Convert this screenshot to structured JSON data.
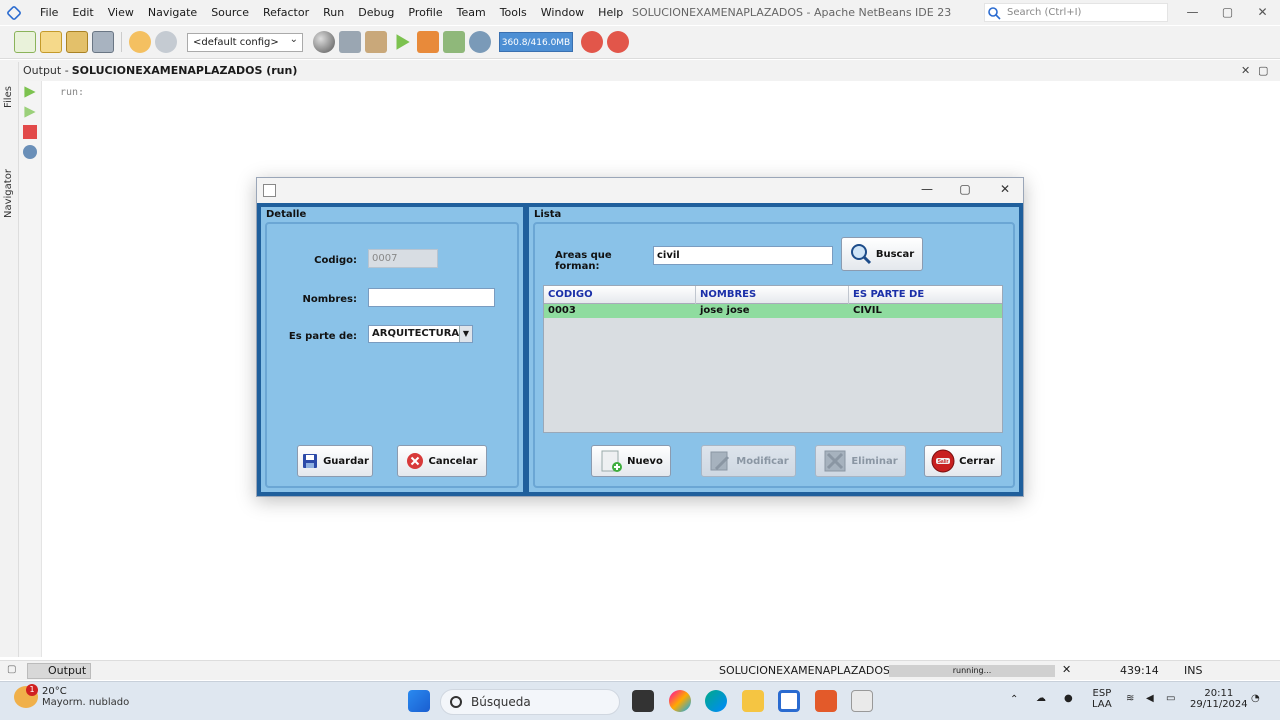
{
  "ide": {
    "menu": [
      "File",
      "Edit",
      "View",
      "Navigate",
      "Source",
      "Refactor",
      "Run",
      "Debug",
      "Profile",
      "Team",
      "Tools",
      "Window",
      "Help"
    ],
    "window_title": "SOLUCIONEXAMENAPLAZADOS - Apache NetBeans IDE 23",
    "search_placeholder": "Search (Ctrl+I)",
    "config": "<default config>",
    "memory": "360.8/416.0MB",
    "output_prefix": "Output - ",
    "output_title": "SOLUCIONEXAMENAPLAZADOS (run)",
    "output_text": "run:",
    "rail_files": "Files",
    "rail_navigator": "Navigator"
  },
  "statusbar": {
    "output_tab": "Output",
    "project": "SOLUCIONEXAMENAPLAZADOS (run)",
    "progress": "running...",
    "position": "439:14",
    "mode": "INS"
  },
  "taskbar": {
    "temperature": "20°C",
    "weather": "Mayorm. nublado",
    "weather_badge": "1",
    "search": "Búsqueda",
    "lang1": "ESP",
    "lang2": "LAA",
    "time": "20:11",
    "date": "29/11/2024"
  },
  "dialog": {
    "detalle": {
      "title": "Detalle",
      "codigo_label": "Codigo:",
      "codigo_value": "0007",
      "nombres_label": "Nombres:",
      "nombres_value": "",
      "parte_label": "Es parte de:",
      "parte_value": "ARQUITECTURA",
      "guardar": "Guardar",
      "cancelar": "Cancelar"
    },
    "lista": {
      "title": "Lista",
      "areas_label": "Areas que forman:",
      "areas_value": "civil",
      "buscar": "Buscar",
      "columns": [
        "CODIGO",
        "NOMBRES",
        "ES PARTE DE"
      ],
      "rows": [
        [
          "0003",
          "jose jose",
          "CIVIL"
        ]
      ],
      "nuevo": "Nuevo",
      "modificar": "Modificar",
      "eliminar": "Eliminar",
      "cerrar": "Cerrar",
      "cerrar_icon_text": "Salir"
    }
  },
  "colors": {
    "panel_bg": "#8ac2e8",
    "frame": "#1f5f9c",
    "selected_row": "#8fdc9f",
    "header_text": "#1a2fa8"
  }
}
